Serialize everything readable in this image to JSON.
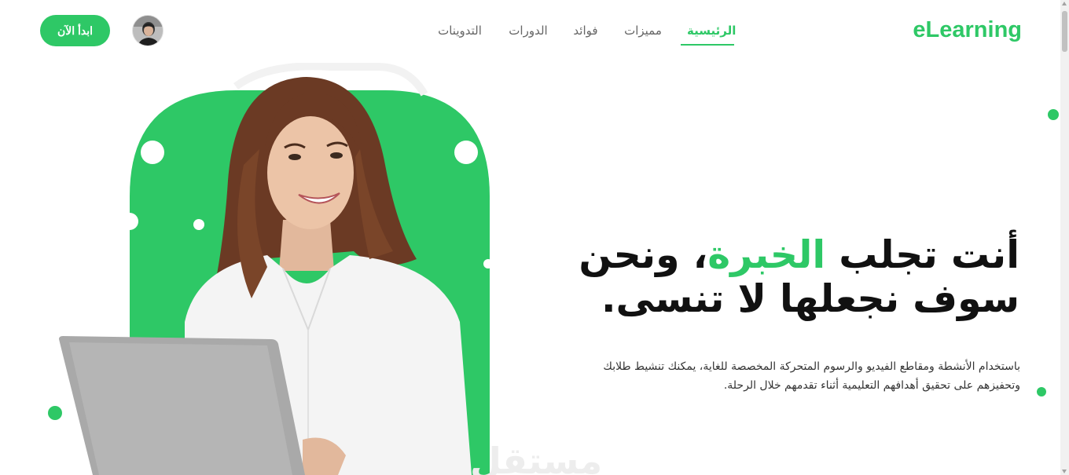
{
  "header": {
    "brand": "eLearning",
    "nav": [
      {
        "label": "الرئيسية",
        "active": true
      },
      {
        "label": "مميزات",
        "active": false
      },
      {
        "label": "فوائد",
        "active": false
      },
      {
        "label": "الدورات",
        "active": false
      },
      {
        "label": "التدوينات",
        "active": false
      }
    ],
    "cta_label": "ابدأ الآن"
  },
  "hero": {
    "title_part1": "أنت تجلب",
    "title_accent": "الخبرة",
    "title_part2": "، ونحن سوف نجعلها لا تنسى.",
    "description": "باستخدام الأنشطة ومقاطع الفيديو والرسوم المتحركة المخصصة للغاية، يمكنك تنشيط طلابك وتحفيزهم على تحقيق أهدافهم التعليمية أثناء تقدمهم خلال الرحلة.",
    "image_subject": "smiling-woman-with-laptop",
    "watermark": "مستقل"
  },
  "colors": {
    "accent": "#2ec866",
    "text": "#111111",
    "nav_text": "#666666"
  },
  "icons": {
    "avatar": "user-avatar",
    "scroll_up": "chevron-up-icon",
    "scroll_down": "chevron-down-icon"
  }
}
